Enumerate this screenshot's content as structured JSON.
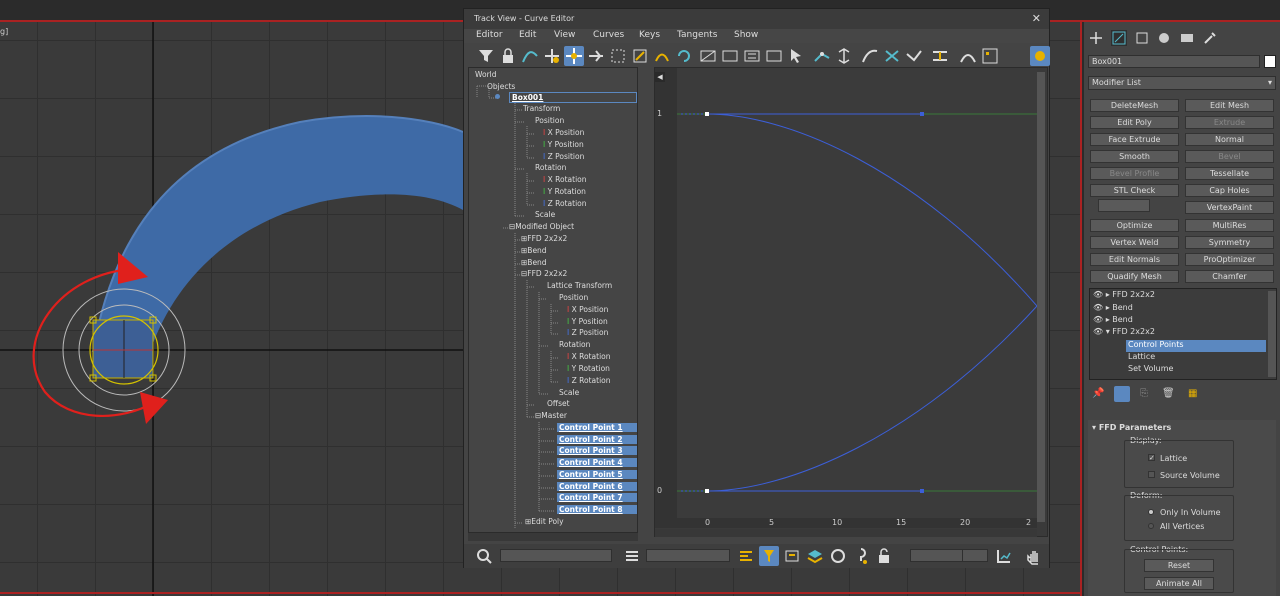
{
  "viewport": {
    "label": "g]"
  },
  "curve_editor": {
    "title": "Track View - Curve Editor",
    "close": "✕",
    "menu": [
      "Editor",
      "Edit",
      "View",
      "Curves",
      "Keys",
      "Tangents",
      "Show"
    ],
    "tree": {
      "world": "World",
      "objects": "Objects",
      "box": "Box001",
      "transform": "Transform",
      "position": "Position",
      "x_position": "X Position",
      "y_position": "Y Position",
      "z_position": "Z Position",
      "rotation": "Rotation",
      "x_rotation": "X Rotation",
      "y_rotation": "Y Rotation",
      "z_rotation": "Z Rotation",
      "scale": "Scale",
      "modified_object": "Modified Object",
      "ffd1": "FFD 2x2x2",
      "bend1": "Bend",
      "bend2": "Bend",
      "ffd2": "FFD 2x2x2",
      "lattice_transform": "Lattice Transform",
      "lt_position": "Position",
      "lt_x_position": "X Position",
      "lt_y_position": "Y Position",
      "lt_z_position": "Z Position",
      "lt_rotation": "Rotation",
      "lt_x_rotation": "X Rotation",
      "lt_y_rotation": "Y Rotation",
      "lt_z_rotation": "Z Rotation",
      "lt_scale": "Scale",
      "offset": "Offset",
      "master": "Master",
      "control_points": [
        "Control Point 1",
        "Control Point 2",
        "Control Point 3",
        "Control Point 4",
        "Control Point 5",
        "Control Point 6",
        "Control Point 7",
        "Control Point 8"
      ],
      "edit_poly": "Edit Poly"
    },
    "graph": {
      "y_labels": [
        "1",
        "0"
      ],
      "x_labels": [
        "0",
        "5",
        "10",
        "15",
        "20",
        "2"
      ]
    }
  },
  "command_panel": {
    "object_name": "Box001",
    "modifier_list": "Modifier List",
    "buttons": [
      {
        "label": "DeleteMesh",
        "enabled": true
      },
      {
        "label": "Edit Mesh",
        "enabled": true
      },
      {
        "label": "Edit Poly",
        "enabled": true
      },
      {
        "label": "Extrude",
        "enabled": false
      },
      {
        "label": "Face Extrude",
        "enabled": true
      },
      {
        "label": "Normal",
        "enabled": true
      },
      {
        "label": "Smooth",
        "enabled": true
      },
      {
        "label": "Bevel",
        "enabled": false
      },
      {
        "label": "Bevel Profile",
        "enabled": false
      },
      {
        "label": "Tessellate",
        "enabled": true
      },
      {
        "label": "STL Check",
        "enabled": true
      },
      {
        "label": "Cap Holes",
        "enabled": true
      },
      {
        "label": "",
        "enabled": false
      },
      {
        "label": "VertexPaint",
        "enabled": true
      },
      {
        "label": "Optimize",
        "enabled": true
      },
      {
        "label": "MultiRes",
        "enabled": true
      },
      {
        "label": "Vertex Weld",
        "enabled": true
      },
      {
        "label": "Symmetry",
        "enabled": true
      },
      {
        "label": "Edit Normals",
        "enabled": true
      },
      {
        "label": "ProOptimizer",
        "enabled": true
      },
      {
        "label": "Quadify Mesh",
        "enabled": true
      },
      {
        "label": "Chamfer",
        "enabled": true
      }
    ],
    "stack": [
      "FFD 2x2x2",
      "Bend",
      "Bend",
      "FFD 2x2x2",
      "Control Points",
      "Lattice",
      "Set Volume"
    ],
    "ffd": {
      "rollout_title": "FFD Parameters",
      "display_label": "Display:",
      "lattice": "Lattice",
      "source_volume": "Source Volume",
      "deform_label": "Deform:",
      "only_in_volume": "Only In Volume",
      "all_vertices": "All Vertices",
      "control_points_label": "Control Points:",
      "reset": "Reset",
      "animate_all": "Animate All"
    }
  }
}
